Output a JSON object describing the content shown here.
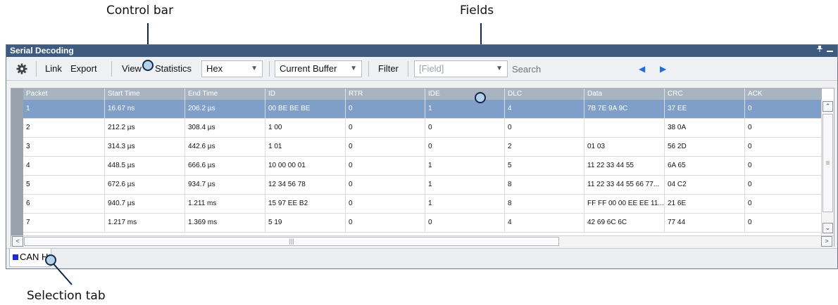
{
  "annotations": {
    "control_bar": "Control bar",
    "fields": "Fields",
    "selection_tab": "Selection tab"
  },
  "window": {
    "title": "Serial Decoding",
    "pin_icon": "pin-icon",
    "minimize_icon": "minimize-icon"
  },
  "toolbar": {
    "settings_icon": "gear-icon",
    "link_label": "Link",
    "export_label": "Export",
    "view_label": "View",
    "statistics_label": "Statistics",
    "format_value": "Hex",
    "buffer_value": "Current Buffer",
    "filter_label": "Filter",
    "field_placeholder": "[Field]",
    "search_placeholder": "Search",
    "prev_icon": "triangle-left-icon",
    "next_icon": "triangle-right-icon"
  },
  "table": {
    "columns": [
      "Packet",
      "Start Time",
      "End Time",
      "ID",
      "RTR",
      "IDE",
      "DLC",
      "Data",
      "CRC",
      "ACK"
    ],
    "rows": [
      [
        "1",
        "16.67 ns",
        "206.2 µs",
        "00 BE BE BE",
        "0",
        "1",
        "4",
        "7B 7E 9A 9C",
        "37 EE",
        "0"
      ],
      [
        "2",
        "212.2 µs",
        "308.4 µs",
        "1 00",
        "0",
        "0",
        "0",
        "",
        "38 0A",
        "0"
      ],
      [
        "3",
        "314.3 µs",
        "442.6 µs",
        "1 01",
        "0",
        "0",
        "2",
        "01 03",
        "56 2D",
        "0"
      ],
      [
        "4",
        "448.5 µs",
        "666.6 µs",
        "10 00 00 01",
        "0",
        "1",
        "5",
        "11 22 33 44 55",
        "6A 65",
        "0"
      ],
      [
        "5",
        "672.6 µs",
        "934.7 µs",
        "12 34 56 78",
        "0",
        "1",
        "8",
        "11 22 33 44 55 66 77...",
        "04 C2",
        "0"
      ],
      [
        "6",
        "940.7 µs",
        "1.211 ms",
        "15 97 EE B2",
        "0",
        "1",
        "8",
        "FF FF 00 00 EE EE 11...",
        "21 6E",
        "0"
      ],
      [
        "7",
        "1.217 ms",
        "1.369 ms",
        "5 19",
        "0",
        "0",
        "4",
        "42 69 6C 6C",
        "77 44",
        "0"
      ]
    ],
    "selected_row": 0
  },
  "tabs": {
    "active_label": "CAN H"
  }
}
